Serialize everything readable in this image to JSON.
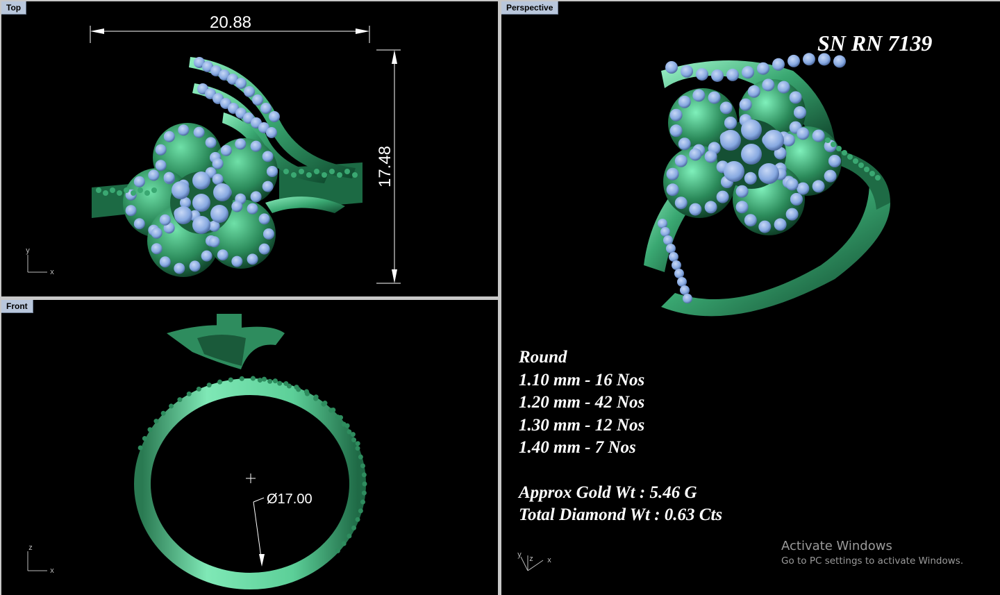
{
  "viewports": {
    "top": {
      "label": "Top",
      "dim_width": "20.88",
      "dim_height": "17.48",
      "axis_x": "x",
      "axis_y": "y"
    },
    "front": {
      "label": "Front",
      "dim_diameter": "Ø17.00",
      "axis_x": "x",
      "axis_z": "z"
    },
    "perspective": {
      "label": "Perspective",
      "axis_x": "x",
      "axis_y": "y",
      "axis_z": "z"
    }
  },
  "design": {
    "serial": "SN RN 7139",
    "stone_shape": "Round",
    "stones": [
      "1.10 mm - 16 Nos",
      "1.20 mm - 42 Nos",
      "1.30 mm - 12 Nos",
      "1.40 mm - 7 Nos"
    ],
    "gold_weight": "Approx Gold Wt : 5.46 G",
    "diamond_weight": "Total Diamond Wt : 0.63 Cts"
  },
  "watermark": {
    "title": "Activate Windows",
    "subtitle": "Go to PC settings to activate Windows."
  },
  "colors": {
    "background": "#000000",
    "metal": "#2e8c5e",
    "metal_light": "#5fcf98",
    "diamond": "#8fb0e6",
    "tab": "#b9c7dc"
  }
}
